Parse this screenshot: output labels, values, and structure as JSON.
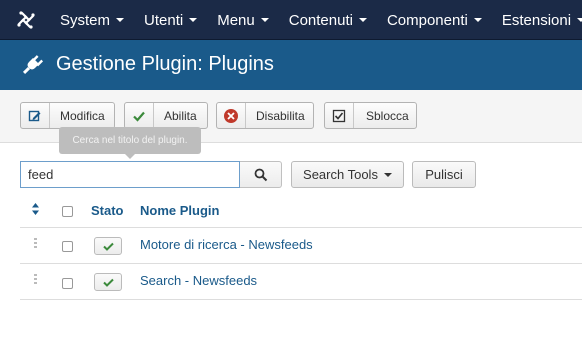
{
  "navbar": {
    "items": [
      {
        "label": "System"
      },
      {
        "label": "Utenti"
      },
      {
        "label": "Menu"
      },
      {
        "label": "Contenuti"
      },
      {
        "label": "Componenti"
      },
      {
        "label": "Estensioni"
      }
    ]
  },
  "header": {
    "title": "Gestione Plugin: Plugins"
  },
  "toolbar": {
    "edit_label": "Modifica",
    "enable_label": "Abilita",
    "disable_label": "Disabilita",
    "unlock_label": "Sblocca"
  },
  "tooltip": {
    "text": "Cerca nel titolo del plugin."
  },
  "search": {
    "value": "feed",
    "tools_label": "Search Tools",
    "clear_label": "Pulisci"
  },
  "table": {
    "headers": {
      "status": "Stato",
      "name": "Nome Plugin"
    },
    "rows": [
      {
        "name": "Motore di ricerca - Newsfeeds",
        "enabled": true
      },
      {
        "name": "Search - Newsfeeds",
        "enabled": true
      }
    ]
  },
  "colors": {
    "navbar": "#1b2a47",
    "header": "#1a5a8a",
    "link": "#1a5a8a",
    "check": "#3c8a3c",
    "disable": "#c0392b"
  }
}
